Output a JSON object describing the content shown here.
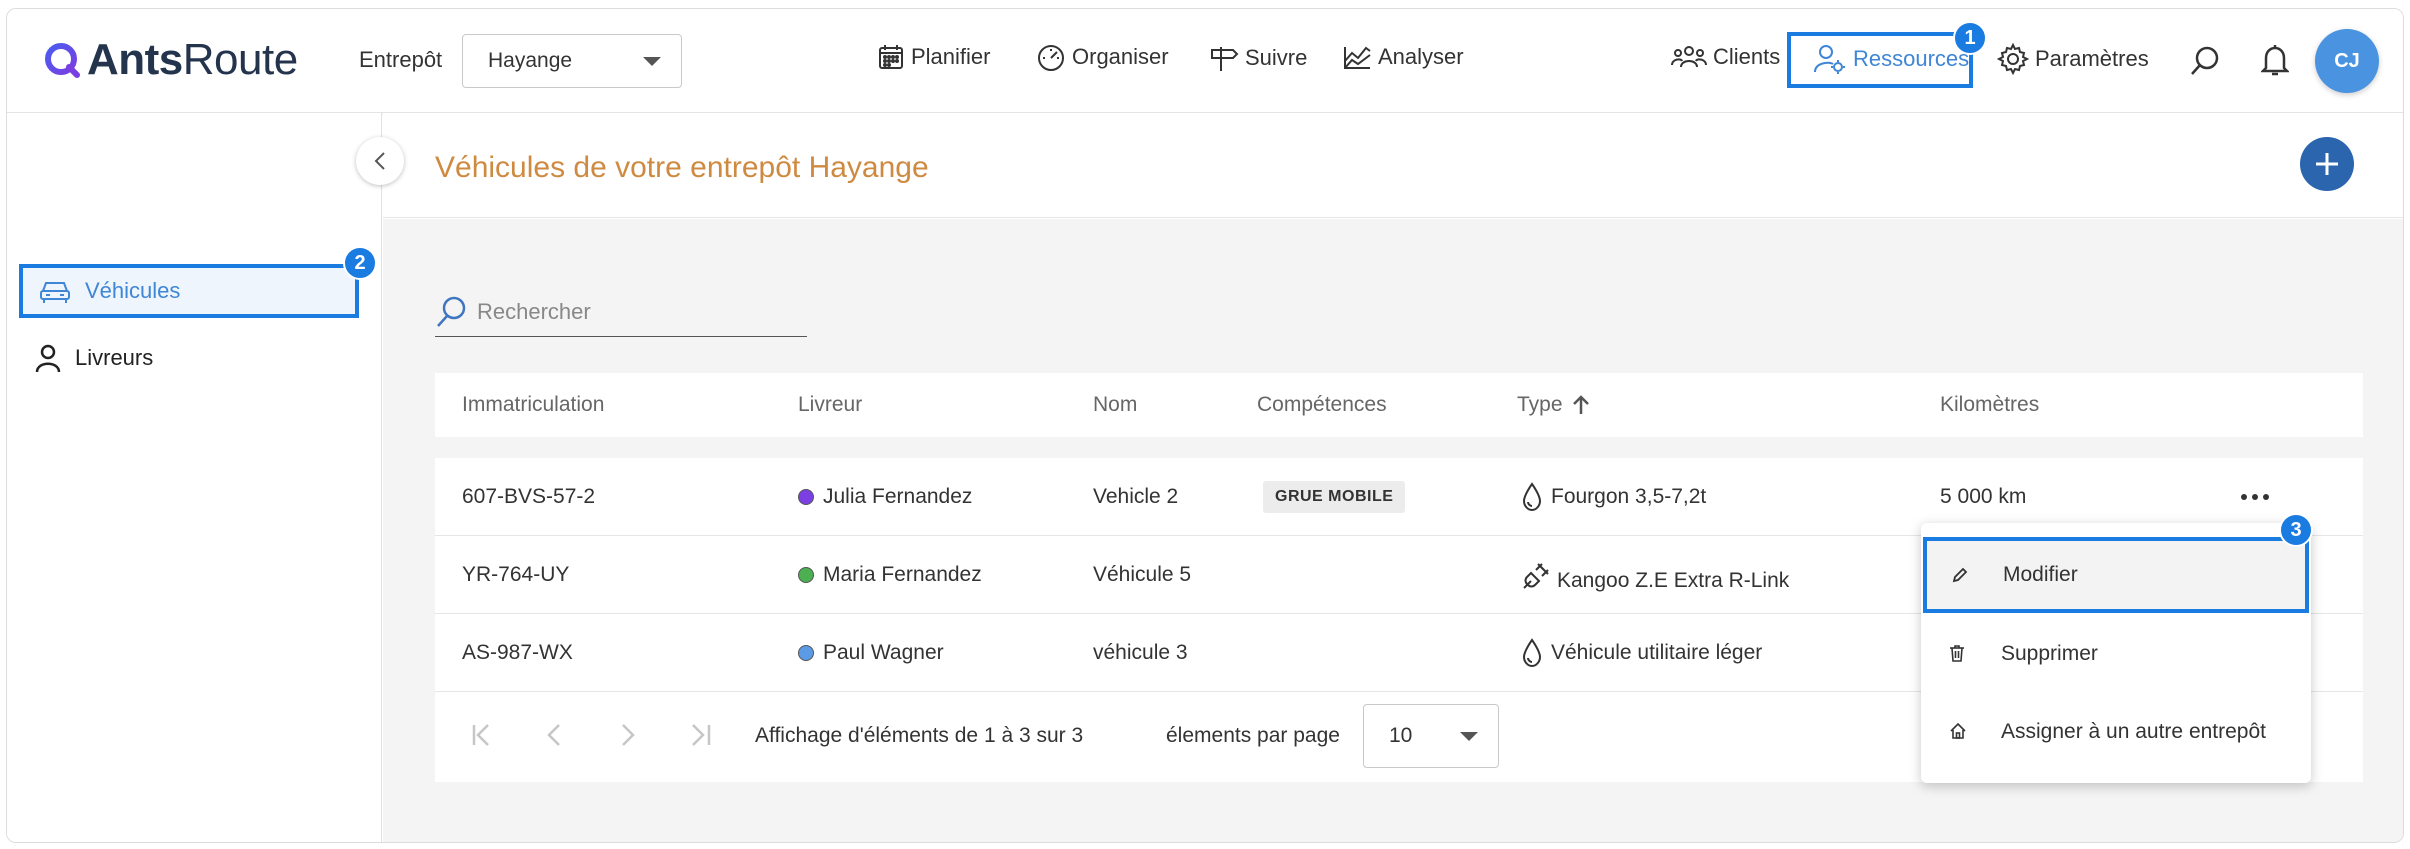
{
  "app": {
    "logo_text_bold": "Ants",
    "logo_text_regular": "Route"
  },
  "header": {
    "warehouse_label": "Entrepôt",
    "warehouse_value": "Hayange",
    "nav": [
      {
        "label": "Planifier",
        "icon": "calendar-icon"
      },
      {
        "label": "Organiser",
        "icon": "speedometer-icon"
      },
      {
        "label": "Suivre",
        "icon": "signpost-icon"
      },
      {
        "label": "Analyser",
        "icon": "chart-icon"
      }
    ],
    "clients_label": "Clients",
    "ressources_label": "Ressources",
    "parametres_label": "Paramètres",
    "avatar_initials": "CJ"
  },
  "badges": {
    "b1": "1",
    "b2": "2",
    "b3": "3"
  },
  "sidebar": {
    "items": [
      {
        "label": "Véhicules",
        "icon": "car-icon",
        "active": true
      },
      {
        "label": "Livreurs",
        "icon": "person-icon",
        "active": false
      }
    ]
  },
  "page": {
    "title": "Véhicules de votre entrepôt Hayange",
    "search_placeholder": "Rechercher"
  },
  "table": {
    "columns": [
      "Immatriculation",
      "Livreur",
      "Nom",
      "Compétences",
      "Type",
      "Kilomètres"
    ],
    "rows": [
      {
        "plate": "607-BVS-57-2",
        "driver": "Julia Fernandez",
        "driver_color": "#7b3fe4",
        "name": "Vehicle 2",
        "skill": "GRUE MOBILE",
        "type_icon": "fuel-drop-icon",
        "type": "Fourgon 3,5-7,2t",
        "km": "5 000 km"
      },
      {
        "plate": "YR-764-UY",
        "driver": "Maria Fernandez",
        "driver_color": "#4caf50",
        "name": "Véhicule 5",
        "skill": "",
        "type_icon": "electric-plug-icon",
        "type": "Kangoo Z.E Extra R-Link",
        "km": ""
      },
      {
        "plate": "AS-987-WX",
        "driver": "Paul Wagner",
        "driver_color": "#5b9be6",
        "name": "véhicule 3",
        "skill": "",
        "type_icon": "fuel-drop-icon",
        "type": "Véhicule utilitaire léger",
        "km": ""
      }
    ]
  },
  "pagination": {
    "summary": "Affichage d'éléments de 1 à 3 sur 3",
    "per_page_label": "élements par page",
    "per_page_value": "10"
  },
  "context_menu": {
    "items": [
      {
        "label": "Modifier",
        "icon": "pencil-icon"
      },
      {
        "label": "Supprimer",
        "icon": "trash-icon"
      },
      {
        "label": "Assigner à un autre entrepôt",
        "icon": "home-icon"
      }
    ]
  },
  "colors": {
    "accent": "#1a7be0",
    "title": "#cf8a42",
    "add_button": "#2a65ad"
  }
}
